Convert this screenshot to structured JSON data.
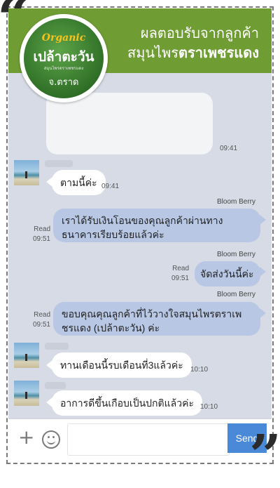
{
  "banner": {
    "line1": "ผลตอบรับจากลูกค้า",
    "line2_regular": "สมุนไพร",
    "line2_bold": "ตราเพชรแดง",
    "color": "#6f9d34"
  },
  "logo": {
    "organic": "Organic",
    "name": "เปล้าตะวัน",
    "subtitle": "สมุนไพรตราเพชรแดง",
    "province": "จ.ตราด"
  },
  "messages": [
    {
      "direction": "in",
      "type": "image",
      "time": "09:41"
    },
    {
      "direction": "in",
      "text": "ตามนี้ค่ะ",
      "time": "09:41"
    },
    {
      "direction": "out",
      "sender": "Bloom Berry",
      "line1": "เราได้รับเงินโอนของคุณลูกค้าผ่านทาง",
      "line2": "ธนาคารเรียบร้อยแล้วค่ะ",
      "status": "Read",
      "time": "09:51"
    },
    {
      "direction": "out",
      "sender": "Bloom Berry",
      "text": "จัดส่งวันนี้ค่ะ",
      "status": "Read",
      "time": "09:51"
    },
    {
      "direction": "out",
      "sender": "Bloom Berry",
      "line1": "ขอบคุณคุณลูกค้าที่ไว้วางใจสมุนไพรตราเพ",
      "line2": "ชรแดง (เปล้าตะวัน) ค่ะ",
      "status": "Read",
      "time": "09:51"
    },
    {
      "direction": "in",
      "text": "ทานเดือนนี้รบเดือนที่3แล้วค่ะ",
      "time": "10:10"
    },
    {
      "direction": "in",
      "text": "อาการดีขึ้นเกือบเป็นปกติแล้วค่ะ",
      "time": "10:10"
    }
  ],
  "input": {
    "plus": "+",
    "placeholder": "",
    "send_label": "Send",
    "accent": "#4a88d8"
  },
  "quotes": {
    "open": "“",
    "close": "”"
  }
}
